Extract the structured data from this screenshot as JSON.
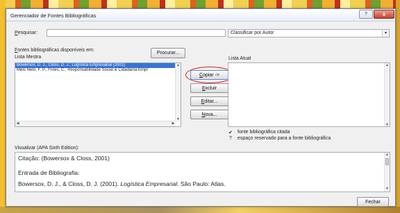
{
  "window": {
    "title": "Gerenciador de Fontes Bibliográficas",
    "help_label": "?",
    "close_label": "x"
  },
  "search": {
    "label_prefix": "",
    "label_key": "P",
    "label_rest": "esquisar:",
    "value": "",
    "placeholder": ""
  },
  "sort": {
    "selected": "Classificar por Autor",
    "arrow": "▾"
  },
  "sources": {
    "label_key": "F",
    "label_rest": "ontes bibliográficas disponíveis em:",
    "sublabel": "Lista Mestra",
    "browse_button": "Procurar...",
    "items": [
      "Bowersox, D. J., Closs, D. J.; Logística Empresarial (2001)",
      "Melo Neto, F. P., Froes, C.; Responsabilidade Social & Cidadania Empr"
    ],
    "selected_index": 0
  },
  "actions": {
    "copy": "Copiar ->",
    "delete": "Excluir",
    "edit": "Editar...",
    "new": "Nova..."
  },
  "current": {
    "label": "Lista Atual",
    "items": []
  },
  "legend": {
    "cited_symbol": "✔",
    "cited_text": "fonte bibliográfica citada",
    "placeholder_symbol": "?",
    "placeholder_text": "espaço reservado para a fonte bibliográfica"
  },
  "preview": {
    "label": "Visualizar (APA Sixth Edition):",
    "citation": "Citação:  (Bowersox & Closs, 2001)",
    "bib_heading": "Entrada de Bibliografia:",
    "bib_prefix": "Bowersox, D. J., & Closs, D. J. (2001). ",
    "bib_title": "Logística Empresarial.",
    "bib_suffix": " São Paulo: Atlas."
  },
  "footer": {
    "close_button": "Fechar"
  }
}
